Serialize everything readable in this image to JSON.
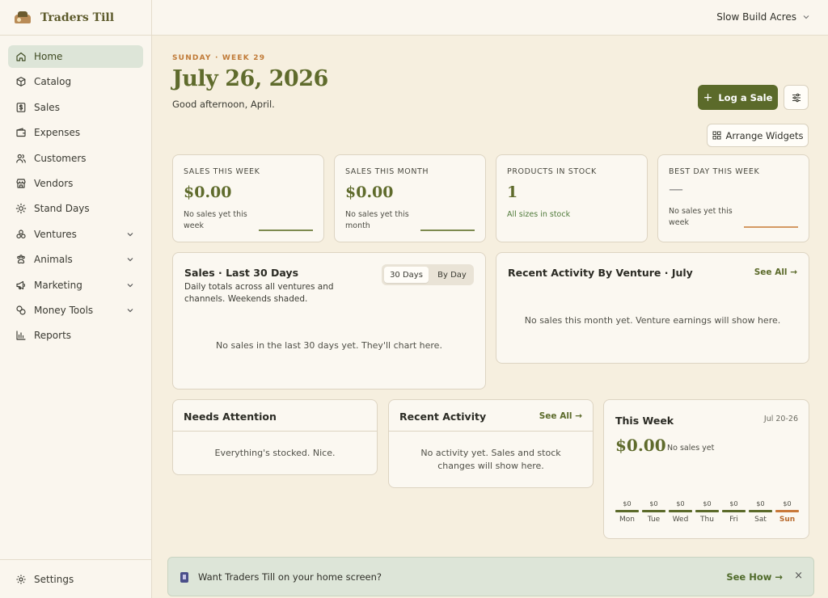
{
  "app": {
    "name": "Traders Till",
    "account": "Slow Build Acres"
  },
  "sidebar": {
    "items": [
      {
        "label": "Home",
        "icon": "home-icon",
        "active": true,
        "expandable": false
      },
      {
        "label": "Catalog",
        "icon": "box-icon",
        "active": false,
        "expandable": false
      },
      {
        "label": "Sales",
        "icon": "dollar-icon",
        "active": false,
        "expandable": false
      },
      {
        "label": "Expenses",
        "icon": "wallet-icon",
        "active": false,
        "expandable": false
      },
      {
        "label": "Customers",
        "icon": "users-icon",
        "active": false,
        "expandable": false
      },
      {
        "label": "Vendors",
        "icon": "store-icon",
        "active": false,
        "expandable": false
      },
      {
        "label": "Stand Days",
        "icon": "sun-icon",
        "active": false,
        "expandable": false
      },
      {
        "label": "Ventures",
        "icon": "ventures-icon",
        "active": false,
        "expandable": true
      },
      {
        "label": "Animals",
        "icon": "paw-icon",
        "active": false,
        "expandable": true
      },
      {
        "label": "Marketing",
        "icon": "megaphone-icon",
        "active": false,
        "expandable": true
      },
      {
        "label": "Money Tools",
        "icon": "coins-icon",
        "active": false,
        "expandable": true
      },
      {
        "label": "Reports",
        "icon": "bar-chart-icon",
        "active": false,
        "expandable": false
      }
    ],
    "settings_label": "Settings"
  },
  "header": {
    "eyebrow": "SUNDAY · WEEK 29",
    "date": "July 26, 2026",
    "greeting": "Good afternoon, April.",
    "log_sale_label": "Log a Sale",
    "arrange_label": "Arrange Widgets"
  },
  "stats": [
    {
      "label": "SALES THIS WEEK",
      "value": "$0.00",
      "sub": "No sales yet this week"
    },
    {
      "label": "SALES THIS MONTH",
      "value": "$0.00",
      "sub": "No sales yet this month"
    },
    {
      "label": "PRODUCTS IN STOCK",
      "value": "1",
      "sub": "All sizes in stock"
    },
    {
      "label": "BEST DAY THIS WEEK",
      "value": "—",
      "sub": "No sales yet this week"
    }
  ],
  "sales30": {
    "title": "Sales · Last 30 Days",
    "desc": "Daily totals across all ventures and channels. Weekends shaded.",
    "tab_active": "30 Days",
    "tab_other": "By Day",
    "empty": "No sales in the last 30 days yet. They'll chart here."
  },
  "venture_activity": {
    "title": "Recent Activity By Venture · July",
    "see_all": "See All →",
    "empty": "No sales this month yet. Venture earnings will show here."
  },
  "needs_attention": {
    "title": "Needs Attention",
    "empty": "Everything's stocked. Nice."
  },
  "recent_activity": {
    "title": "Recent Activity",
    "see_all": "See All →",
    "empty": "No activity yet. Sales and stock changes will show here."
  },
  "this_week": {
    "title": "This Week",
    "range": "Jul 20-26",
    "total": "$0.00",
    "note": "No sales yet",
    "days": [
      {
        "name": "Mon",
        "value": "$0"
      },
      {
        "name": "Tue",
        "value": "$0"
      },
      {
        "name": "Wed",
        "value": "$0"
      },
      {
        "name": "Thu",
        "value": "$0"
      },
      {
        "name": "Fri",
        "value": "$0"
      },
      {
        "name": "Sat",
        "value": "$0"
      },
      {
        "name": "Sun",
        "value": "$0",
        "today": true
      }
    ]
  },
  "banner": {
    "text": "Want Traders Till on your home screen?",
    "link": "See How →",
    "close": "×"
  },
  "colors": {
    "accent": "#5b6a2a",
    "orange": "#c8793a",
    "background": "#f6efdf"
  }
}
